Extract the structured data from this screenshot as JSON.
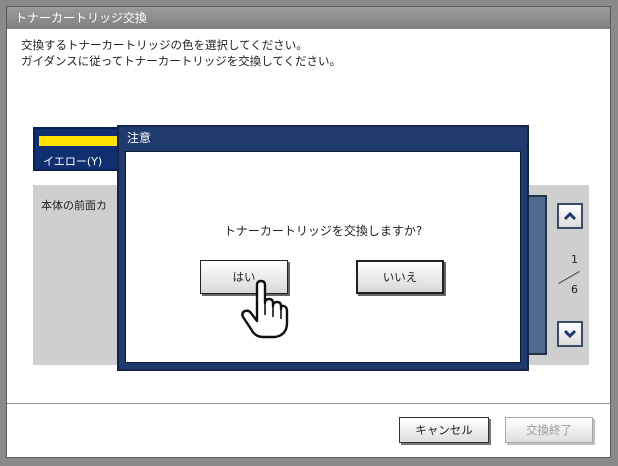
{
  "window": {
    "title": "トナーカートリッジ交換"
  },
  "instructions": {
    "line1": "交換するトナーカートリッジの色を選択してください。",
    "line2": "ガイダンスに従ってトナーカートリッジを交換してください。"
  },
  "color_select": {
    "label": "イエロー(Y)",
    "bar_color": "#ffe200"
  },
  "guidance": {
    "text": "本体の前面カ",
    "page": {
      "current": "1",
      "total": "6"
    },
    "scroll_up_icon": "chevron-up-icon",
    "scroll_down_icon": "chevron-down-icon"
  },
  "footer": {
    "cancel_label": "キャンセル",
    "finish_label": "交換終了"
  },
  "dialog": {
    "title": "注意",
    "message": "トナーカートリッジを交換しますか?",
    "yes_label": "はい",
    "no_label": "いいえ"
  },
  "colors": {
    "accent": "#1f3b6e",
    "title_bar": "#8a8a8a",
    "panel": "#cfcfcf"
  }
}
